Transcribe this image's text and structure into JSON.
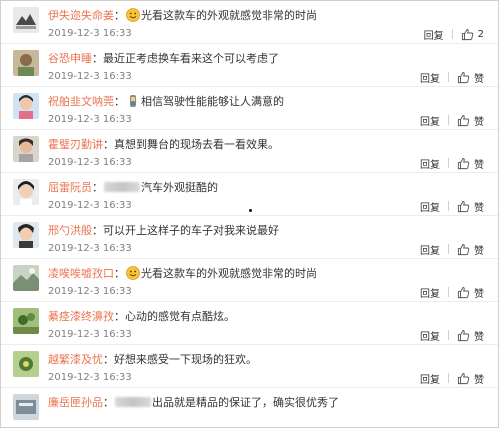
{
  "comments": [
    {
      "user": "伊失迩失命姜",
      "emoji": true,
      "blur": false,
      "text": "光看这款车的外观就感觉非常的时尚",
      "time": "2019-12-3 16:33",
      "reply": "回复",
      "like": "2"
    },
    {
      "user": "谷恐申睡",
      "emoji": false,
      "blur": false,
      "text": "最近正考虑换车看来这个可以考虑了",
      "time": "2019-12-3 16:33",
      "reply": "回复",
      "like": "赞"
    },
    {
      "user": "祝舶韭文呐莞",
      "emoji": true,
      "blur": false,
      "text": "相信驾驶性能能够让人满意的",
      "time": "2019-12-3 16:33",
      "reply": "回复",
      "like": "赞"
    },
    {
      "user": "霍璧刃勤讲",
      "emoji": false,
      "blur": false,
      "text": "真想到舞台的现场去看一看效果。",
      "time": "2019-12-3 16:33",
      "reply": "回复",
      "like": "赞"
    },
    {
      "user": "屈雷阮员",
      "emoji": false,
      "blur": true,
      "text": "汽车外观挺酷的",
      "time": "2019-12-3 16:33",
      "reply": "回复",
      "like": "赞"
    },
    {
      "user": "邢勺洪般",
      "emoji": false,
      "blur": false,
      "text": "可以开上这样子的车子对我来说最好",
      "time": "2019-12-3 16:33",
      "reply": "回复",
      "like": "赞"
    },
    {
      "user": "凌唉唉嘘孜口",
      "emoji": true,
      "blur": false,
      "text": "光看这款车的外观就感觉非常的时尚",
      "time": "2019-12-3 16:33",
      "reply": "回复",
      "like": "赞"
    },
    {
      "user": "綦痉漆终濞孜",
      "emoji": false,
      "blur": false,
      "text": "心动的感觉有点酷炫。",
      "time": "2019-12-3 16:33",
      "reply": "回复",
      "like": "赞"
    },
    {
      "user": "越繁漆及忧",
      "emoji": false,
      "blur": false,
      "text": "好想来感受一下现场的狂欢。",
      "time": "2019-12-3 16:33",
      "reply": "回复",
      "like": "赞"
    },
    {
      "user": "廉岳匣孙品",
      "emoji": false,
      "blur": true,
      "text": "出品就是精品的保证了，确实很优秀了",
      "time": "",
      "reply": "",
      "like": ""
    }
  ],
  "colors": {
    "username": "#eb7350",
    "text": "#333333",
    "time": "#808080"
  },
  "icons": {
    "like": "thumbs-up-icon",
    "emoji": "smile-emoji-icon"
  }
}
